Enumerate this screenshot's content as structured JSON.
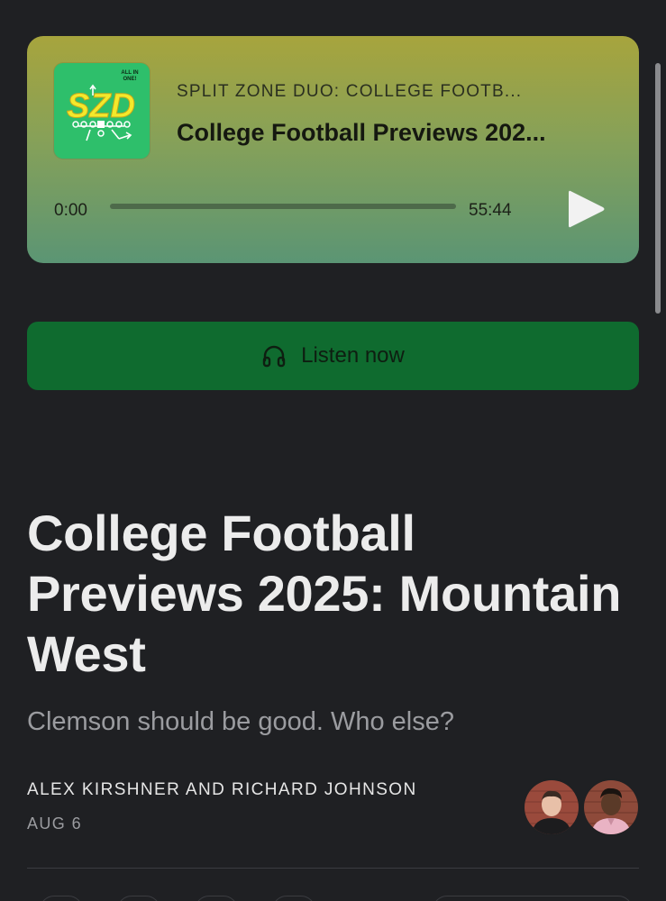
{
  "player": {
    "show_name": "SPLIT ZONE DUO: COLLEGE FOOTB...",
    "episode_title": "College Football Previews 202...",
    "cover_text": "SZD",
    "cover_badge": "ALL IN ONE!",
    "time_current": "0:00",
    "time_total": "55:44",
    "progress_fraction": 0,
    "play_icon": "play-icon",
    "colors": {
      "cover_bg": "#2ebf6b",
      "cover_letters": "#f3e92b"
    }
  },
  "listen_button": {
    "label": "Listen now",
    "icon": "headphones-icon",
    "color": "#0f6b2f"
  },
  "article": {
    "title": "College Football Previews 2025: Mountain West",
    "subtitle": "Clemson should be good. Who else?",
    "authors": "ALEX KIRSHNER AND RICHARD JOHNSON",
    "date": "AUG 6"
  }
}
